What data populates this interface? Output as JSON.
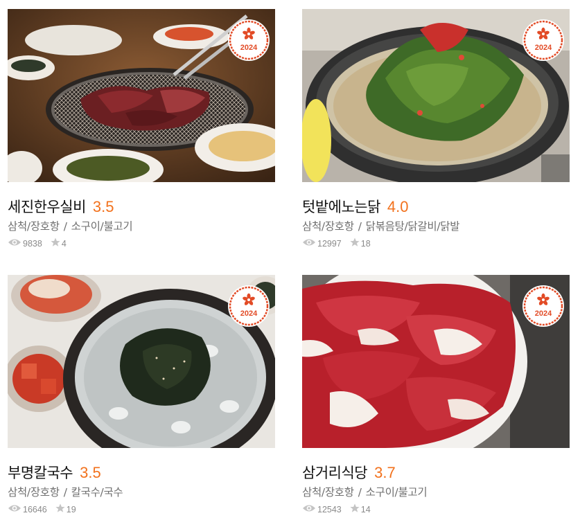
{
  "accent_color": "#f2711c",
  "badge": {
    "year": "2024",
    "icon": "flower-icon",
    "color": "#e24b26"
  },
  "restaurants": [
    {
      "name": "세진한우실비",
      "score": "3.5",
      "region": "삼척/장호항",
      "category": "소구이/불고기",
      "views": "9838",
      "reviews": "4"
    },
    {
      "name": "텃밭에노는닭",
      "score": "4.0",
      "region": "삼척/장호항",
      "category": "닭볶음탕/닭갈비/닭발",
      "views": "12997",
      "reviews": "18"
    },
    {
      "name": "부명칼국수",
      "score": "3.5",
      "region": "삼척/장호항",
      "category": "칼국수/국수",
      "views": "16646",
      "reviews": "19"
    },
    {
      "name": "삼거리식당",
      "score": "3.7",
      "region": "삼척/장호항",
      "category": "소구이/불고기",
      "views": "12543",
      "reviews": "14"
    }
  ],
  "separator": "/"
}
